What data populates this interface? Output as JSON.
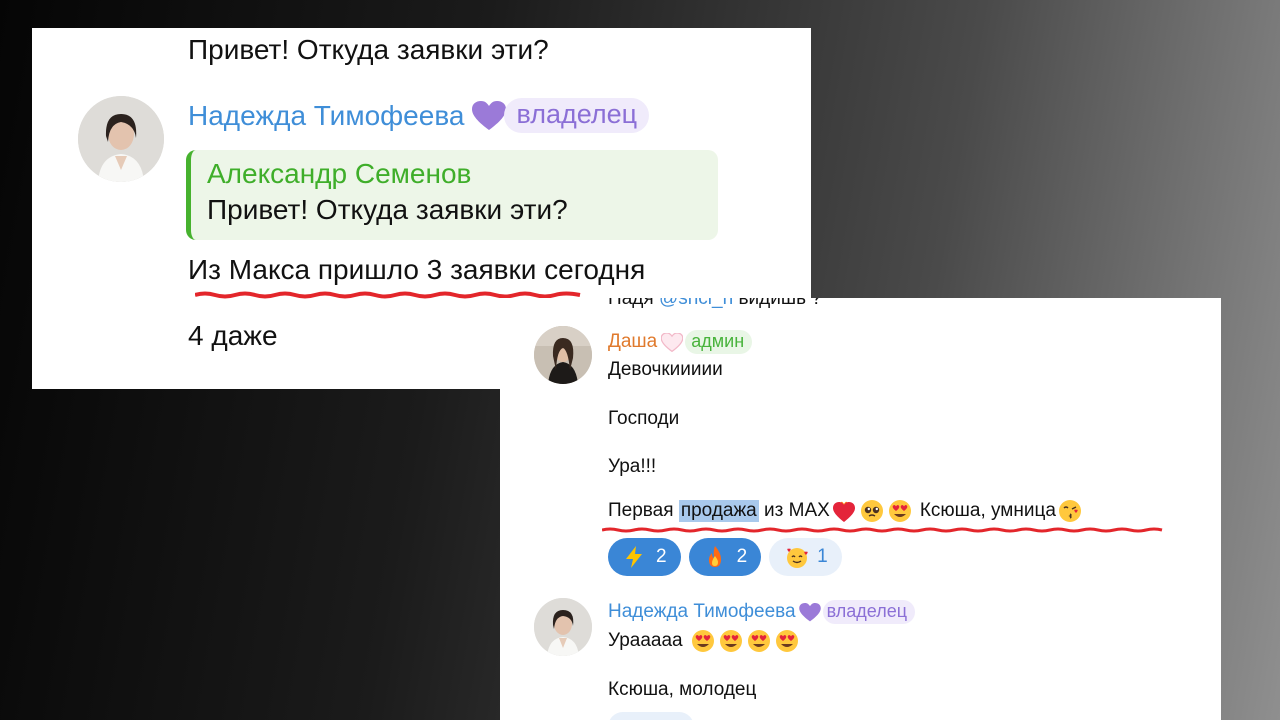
{
  "chat_top": {
    "previous_message": "Привет! Откуда заявки эти?",
    "author": {
      "name": "Надежда Тимофеева",
      "badge": "владелец",
      "heart": "purple-heart-icon",
      "name_color": "#3f8ed8"
    },
    "reply_quote": {
      "author": "Александр Семенов",
      "text": "Привет! Откуда заявки эти?",
      "author_color": "#3fae2a"
    },
    "messages": [
      "Из Макса пришло 3 заявки сегодня",
      "4 даже"
    ]
  },
  "chat_bottom": {
    "cut_line": {
      "prefix": "Надя ",
      "mention": "@snci_n",
      "suffix": " видишь ?"
    },
    "post1": {
      "author": "Даша",
      "badge": "админ",
      "heart": "white-heart-icon",
      "name_color": "#e07a2d",
      "lines": [
        "Девочкиииии",
        "Господи",
        "Ура!!!"
      ],
      "sale_line": {
        "before": "Первая ",
        "highlighted": "продажа",
        "after": " из MAX",
        "tail": "Ксюша, умница",
        "emojis": [
          "heart-on-fire-icon",
          "pleading-face-icon",
          "heart-eyes-icon",
          "kissing-face-icon"
        ]
      },
      "reactions": [
        {
          "icon": "lightning-icon",
          "glyph": "⚡",
          "count": "2",
          "active": true
        },
        {
          "icon": "fire-icon",
          "glyph": "🔥",
          "count": "2",
          "active": true
        },
        {
          "icon": "smiling-face-with-hearts-icon",
          "glyph": "🥰",
          "count": "1",
          "active": false
        }
      ]
    },
    "post2": {
      "author": "Надежда Тимофеева",
      "badge": "владелец",
      "heart": "purple-heart-icon",
      "line1": "Урааааа",
      "line1_emojis": [
        "heart-eyes-icon",
        "heart-eyes-icon",
        "heart-eyes-icon",
        "heart-eyes-icon"
      ],
      "line2": "Ксюша, молодец"
    }
  },
  "colors": {
    "underline_red": "#e3262b",
    "reaction_active": "#3a86d6",
    "highlight": "#a9c9ec"
  }
}
